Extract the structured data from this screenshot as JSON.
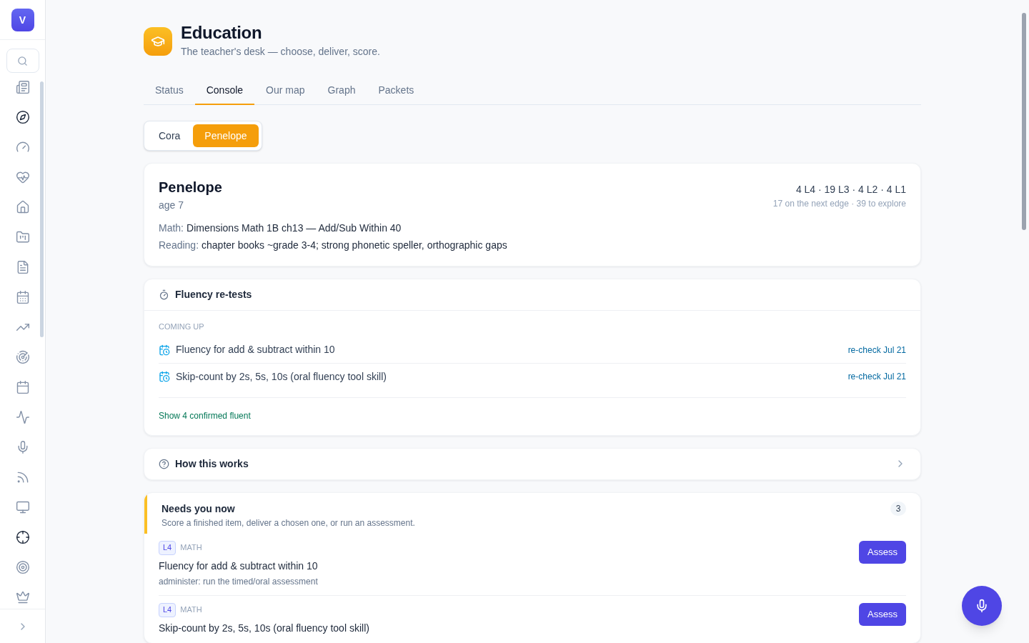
{
  "sidebar": {
    "logo": "V",
    "items": [
      {
        "active": false
      },
      {
        "active": true
      },
      {
        "active": false
      },
      {
        "active": false
      },
      {
        "active": false
      },
      {
        "active": false
      },
      {
        "active": false
      },
      {
        "active": false
      },
      {
        "active": false
      },
      {
        "active": false
      },
      {
        "active": false
      },
      {
        "active": false
      },
      {
        "active": false
      },
      {
        "active": false
      },
      {
        "active": false
      },
      {
        "active": true
      },
      {
        "active": false
      },
      {
        "active": false
      }
    ]
  },
  "header": {
    "title": "Education",
    "subtitle": "The teacher's desk — choose, deliver, score."
  },
  "tabs": [
    {
      "label": "Status",
      "selected": false
    },
    {
      "label": "Console",
      "selected": true
    },
    {
      "label": "Our map",
      "selected": false
    },
    {
      "label": "Graph",
      "selected": false
    },
    {
      "label": "Packets",
      "selected": false
    }
  ],
  "students": [
    {
      "label": "Cora",
      "selected": false
    },
    {
      "label": "Penelope",
      "selected": true
    }
  ],
  "profile": {
    "name": "Penelope",
    "age": "age 7",
    "levels": "4 L4 · 19 L3 · 4 L2 · 4 L1",
    "summary": "17 on the next edge · 39 to explore",
    "lines": [
      {
        "label": "Math:",
        "value": "Dimensions Math 1B ch13 — Add/Sub Within 40"
      },
      {
        "label": "Reading:",
        "value": "chapter books ~grade 3-4; strong phonetic speller, orthographic gaps"
      }
    ]
  },
  "fluency": {
    "title": "Fluency re-tests",
    "section": "COMING UP",
    "items": [
      {
        "name": "Fluency for add & subtract within 10",
        "due": "re-check Jul 21"
      },
      {
        "name": "Skip-count by 2s, 5s, 10s (oral fluency tool skill)",
        "due": "re-check Jul 21"
      }
    ],
    "toggle": "Show 4 confirmed fluent"
  },
  "how": {
    "title": "How this works",
    "expanded": false
  },
  "needs": {
    "title": "Needs you now",
    "subtitle": "Score a finished item, deliver a chosen one, or run an assessment.",
    "count": "3",
    "items": [
      {
        "level": "L4",
        "subject": "MATH",
        "name": "Fluency for add & subtract within 10",
        "note": "administer: run the timed/oral assessment",
        "action": "Assess"
      },
      {
        "level": "L4",
        "subject": "MATH",
        "name": "Skip-count by 2s, 5s, 10s (oral fluency tool skill)",
        "action": "Assess"
      }
    ]
  }
}
